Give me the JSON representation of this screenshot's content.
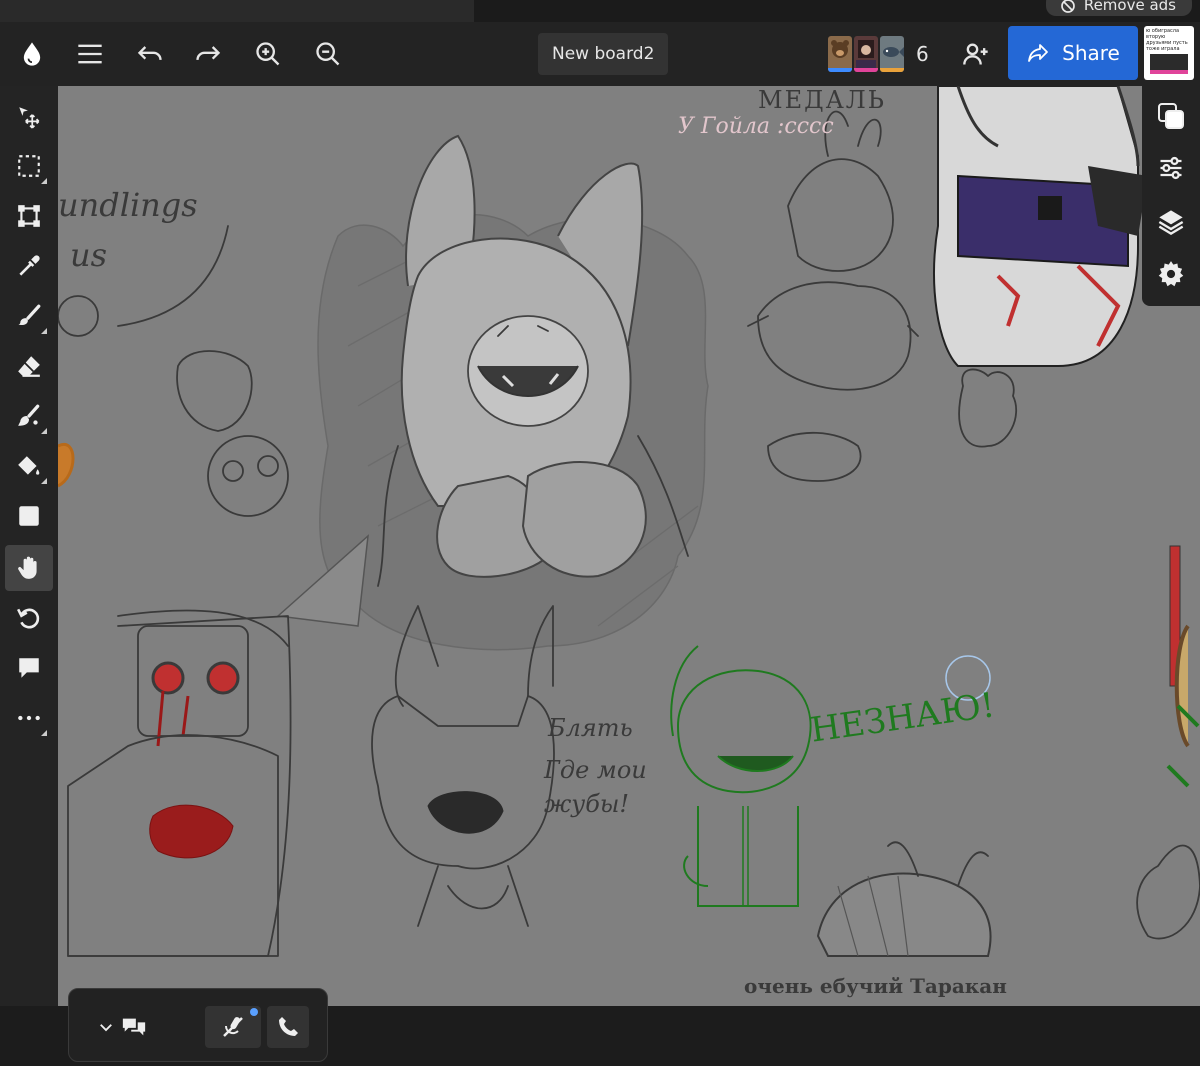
{
  "ads": {
    "remove_label": "Remove ads"
  },
  "board": {
    "name": "New board2"
  },
  "collaborators": {
    "count": "6",
    "avatars": [
      {
        "bar_color": "#3d8bff",
        "fill": "#8a6a4a"
      },
      {
        "bar_color": "#e0449a",
        "fill": "#5a3a3a"
      },
      {
        "bar_color": "#e9a23b",
        "fill": "#6e7a80"
      }
    ]
  },
  "share": {
    "label": "Share"
  },
  "profile": {
    "caption": "ю обиграсла вторую друзьями пусть тоже играла"
  },
  "tools": [
    {
      "name": "move-tool",
      "icon": "move-icon"
    },
    {
      "name": "select-tool",
      "icon": "select-icon"
    },
    {
      "name": "transform-tool",
      "icon": "transform-icon"
    },
    {
      "name": "eyedropper-tool",
      "icon": "eyedropper-icon"
    },
    {
      "name": "brush-tool",
      "icon": "brush-icon"
    },
    {
      "name": "eraser-tool",
      "icon": "eraser-icon"
    },
    {
      "name": "smudge-tool",
      "icon": "smudge-icon"
    },
    {
      "name": "fill-tool",
      "icon": "fill-icon"
    },
    {
      "name": "shape-tool",
      "icon": "square-icon"
    },
    {
      "name": "hand-tool",
      "icon": "hand-icon",
      "active": true
    },
    {
      "name": "rotate-tool",
      "icon": "rotate-icon"
    },
    {
      "name": "comment-tool",
      "icon": "comment-icon"
    },
    {
      "name": "more-tools",
      "icon": "more-icon"
    }
  ],
  "canvas_text": {
    "medal": "МЕДАЛЬ",
    "goila": "У Гойла :сссс",
    "foundlings": "undlings",
    "us": "us",
    "blyat_1": "Блять",
    "blyat_2": "Где мои",
    "blyat_3": "жубы!",
    "neznayu": "НЕЗНАЮ!",
    "tarakan": "очень ебучий Таракан"
  },
  "colors": {
    "canvas": "#808080",
    "accent_blue": "#2468d6",
    "green_ink": "#1f7a1f",
    "blood_red": "#a01818"
  }
}
